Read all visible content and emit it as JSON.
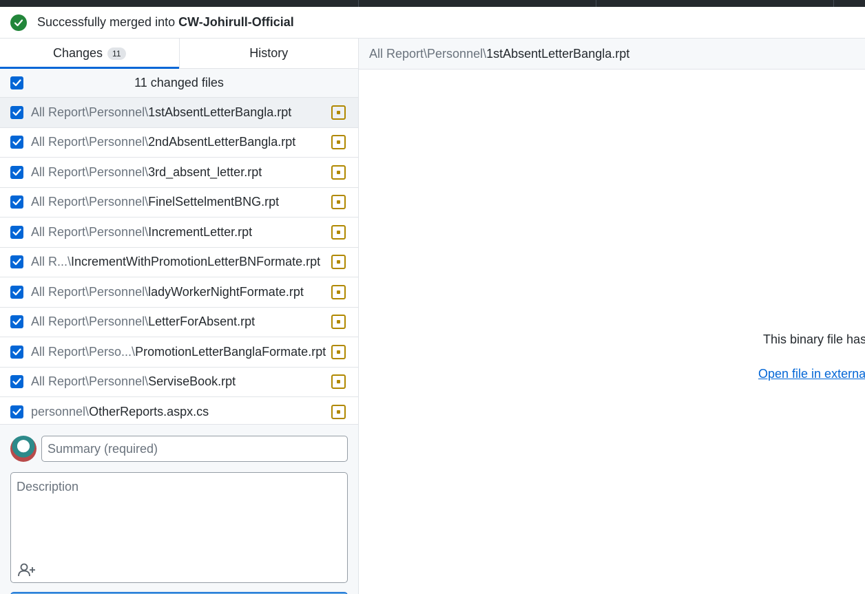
{
  "banner": {
    "message": "Successfully merged into",
    "branch": "CW-Johirull-Official"
  },
  "tabs": {
    "changes_label": "Changes",
    "changes_count": "11",
    "history_label": "History"
  },
  "files_header": {
    "label": "11 changed files"
  },
  "files": [
    {
      "dir": "All Report\\Personnel\\",
      "name": "1stAbsentLetterBangla.rpt"
    },
    {
      "dir": "All Report\\Personnel\\",
      "name": "2ndAbsentLetterBangla.rpt"
    },
    {
      "dir": "All Report\\Personnel\\",
      "name": "3rd_absent_letter.rpt"
    },
    {
      "dir": "All Report\\Personnel\\",
      "name": "FinelSettelmentBNG.rpt"
    },
    {
      "dir": "All Report\\Personnel\\",
      "name": "IncrementLetter.rpt"
    },
    {
      "dir": "All R...\\",
      "name": "IncrementWithPromotionLetterBNFormate.rpt"
    },
    {
      "dir": "All Report\\Personnel\\",
      "name": "ladyWorkerNightFormate.rpt"
    },
    {
      "dir": "All Report\\Personnel\\",
      "name": "LetterForAbsent.rpt"
    },
    {
      "dir": "All Report\\Perso...\\",
      "name": "PromotionLetterBanglaFormate.rpt"
    },
    {
      "dir": "All Report\\Personnel\\",
      "name": "ServiseBook.rpt"
    },
    {
      "dir": "personnel\\",
      "name": "OtherReports.aspx.cs"
    }
  ],
  "commit": {
    "summary_placeholder": "Summary (required)",
    "description_placeholder": "Description"
  },
  "diff": {
    "crumb_dir": "All Report\\Personnel\\",
    "crumb_name": "1stAbsentLetterBangla.rpt",
    "binary_message": "This binary file has",
    "open_link": "Open file in externa"
  },
  "colors": {
    "accent": "#0366d6",
    "success": "#22863a",
    "modified": "#b08800"
  },
  "icons": [
    "check-circle-icon",
    "checkbox-icon",
    "file-modified-icon",
    "person-add-icon"
  ]
}
